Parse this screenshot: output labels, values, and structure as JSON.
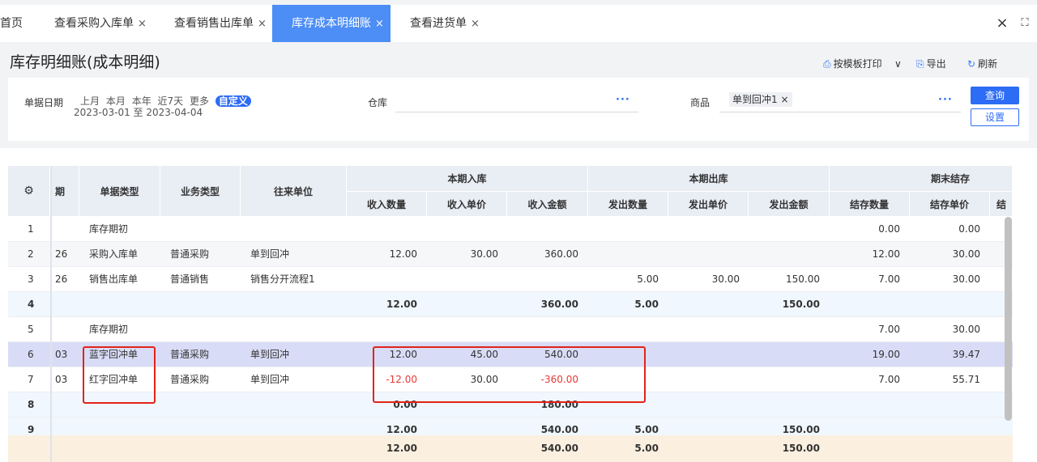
{
  "tabs": [
    {
      "label": "首页",
      "closable": false
    },
    {
      "label": "查看采购入库单",
      "closable": true
    },
    {
      "label": "查看销售出库单",
      "closable": true
    },
    {
      "label": "库存成本明细账",
      "closable": true,
      "active": true
    },
    {
      "label": "查看进货单",
      "closable": true
    }
  ],
  "tab_close_symbol": "×",
  "window_controls": {
    "close": "×",
    "fullscreen": "⛶"
  },
  "page": {
    "title": "库存明细账(成本明细)"
  },
  "toolbar": {
    "print": "按模板打印",
    "print_dropdown": "∨",
    "export": "导出",
    "refresh": "刷新"
  },
  "filter": {
    "date_label": "单据日期",
    "date_options": [
      "上月",
      "本月",
      "本年",
      "近7天",
      "更多"
    ],
    "date_custom": "自定义",
    "date_range": "2023-03-01 至 2023-04-04",
    "warehouse_label": "仓库",
    "warehouse_value": "",
    "product_label": "商品",
    "product_tag": "单到回冲1",
    "tag_close": "×",
    "more_dots": "···",
    "query_button": "查询",
    "settings_button": "设置"
  },
  "table": {
    "group_headers": {
      "in": "本期入库",
      "out": "本期出库",
      "end": "期末结存"
    },
    "columns": {
      "settings_icon": "⚙",
      "date": "期",
      "doc_type": "单据类型",
      "biz_type": "业务类型",
      "partner": "往来单位",
      "in_qty": "收入数量",
      "in_price": "收入单价",
      "in_amount": "收入金额",
      "out_qty": "发出数量",
      "out_price": "发出单价",
      "out_amount": "发出金额",
      "end_qty": "结存数量",
      "end_price": "结存单价",
      "end_amount": "结"
    },
    "rows": [
      {
        "no": "1",
        "date": "",
        "doc_type": "库存期初",
        "biz_type": "",
        "partner": "",
        "in_qty": "",
        "in_price": "",
        "in_amount": "",
        "out_qty": "",
        "out_price": "",
        "out_amount": "",
        "end_qty": "0.00",
        "end_price": "0.00"
      },
      {
        "no": "2",
        "date": "26",
        "doc_type": "采购入库单",
        "biz_type": "普通采购",
        "partner": "单到回冲",
        "in_qty": "12.00",
        "in_price": "30.00",
        "in_amount": "360.00",
        "out_qty": "",
        "out_price": "",
        "out_amount": "",
        "end_qty": "12.00",
        "end_price": "30.00"
      },
      {
        "no": "3",
        "date": "26",
        "doc_type": "销售出库单",
        "biz_type": "普通销售",
        "partner": "销售分开流程1",
        "in_qty": "",
        "in_price": "",
        "in_amount": "",
        "out_qty": "5.00",
        "out_price": "30.00",
        "out_amount": "150.00",
        "end_qty": "7.00",
        "end_price": "30.00"
      },
      {
        "no": "4",
        "date": "",
        "doc_type": "",
        "biz_type": "",
        "partner": "",
        "in_qty": "12.00",
        "in_price": "",
        "in_amount": "360.00",
        "out_qty": "5.00",
        "out_price": "",
        "out_amount": "150.00",
        "end_qty": "",
        "end_price": ""
      },
      {
        "no": "5",
        "date": "",
        "doc_type": "库存期初",
        "biz_type": "",
        "partner": "",
        "in_qty": "",
        "in_price": "",
        "in_amount": "",
        "out_qty": "",
        "out_price": "",
        "out_amount": "",
        "end_qty": "7.00",
        "end_price": "30.00"
      },
      {
        "no": "6",
        "date": "03",
        "doc_type": "蓝字回冲单",
        "biz_type": "普通采购",
        "partner": "单到回冲",
        "in_qty": "12.00",
        "in_price": "45.00",
        "in_amount": "540.00",
        "out_qty": "",
        "out_price": "",
        "out_amount": "",
        "end_qty": "19.00",
        "end_price": "39.47"
      },
      {
        "no": "7",
        "date": "03",
        "doc_type": "红字回冲单",
        "biz_type": "普通采购",
        "partner": "单到回冲",
        "in_qty": "-12.00",
        "in_price": "30.00",
        "in_amount": "-360.00",
        "out_qty": "",
        "out_price": "",
        "out_amount": "",
        "end_qty": "7.00",
        "end_price": "55.71"
      },
      {
        "no": "8",
        "date": "",
        "doc_type": "",
        "biz_type": "",
        "partner": "",
        "in_qty": "0.00",
        "in_price": "",
        "in_amount": "180.00",
        "out_qty": "",
        "out_price": "",
        "out_amount": "",
        "end_qty": "",
        "end_price": ""
      },
      {
        "no": "9",
        "date": "",
        "doc_type": "",
        "biz_type": "",
        "partner": "",
        "in_qty": "12.00",
        "in_price": "",
        "in_amount": "540.00",
        "out_qty": "5.00",
        "out_price": "",
        "out_amount": "150.00",
        "end_qty": "",
        "end_price": ""
      }
    ],
    "total": {
      "in_qty": "12.00",
      "in_amount": "540.00",
      "out_qty": "5.00",
      "out_amount": "150.00"
    }
  },
  "colors": {
    "accent": "#2d6cf5",
    "active_tab": "#4c8df6",
    "highlight_box": "#e2231a",
    "negative": "#e53935"
  }
}
